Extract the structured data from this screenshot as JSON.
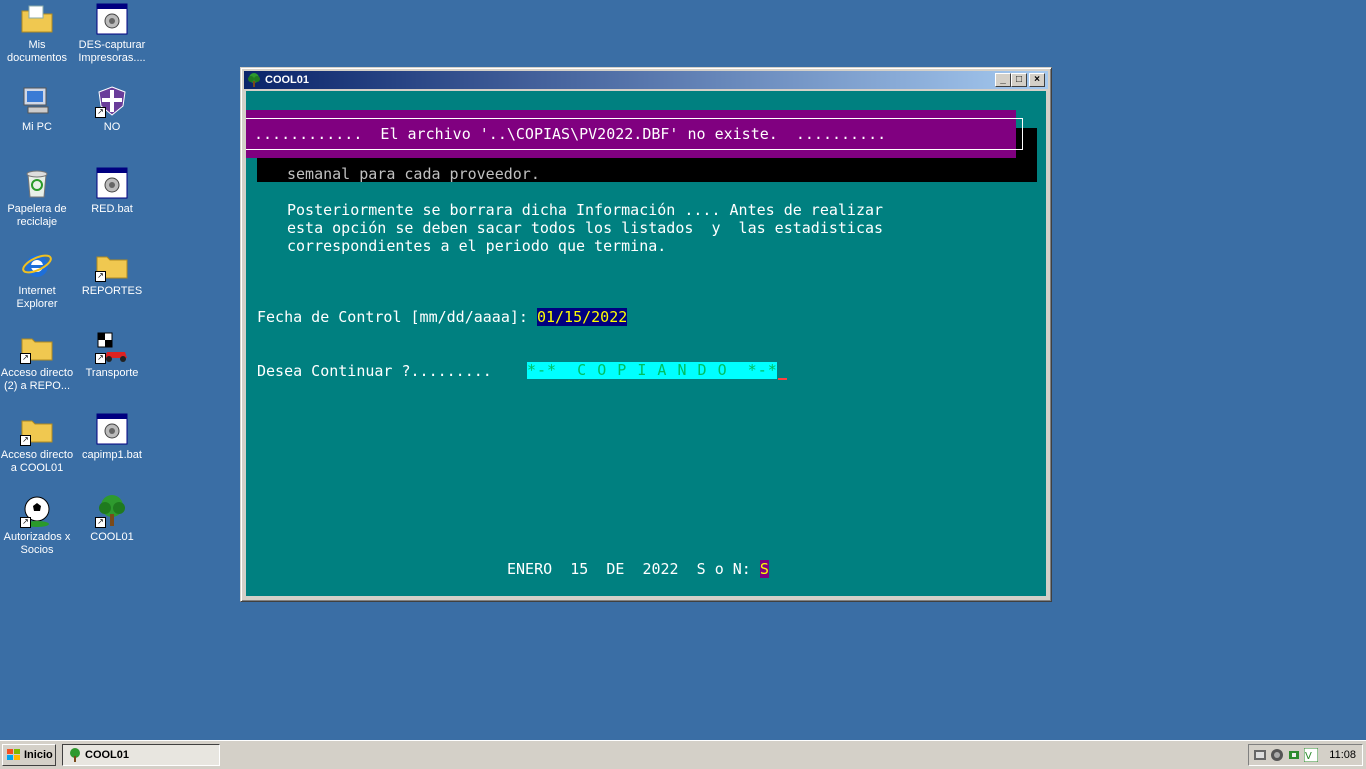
{
  "desktop": {
    "icons": [
      {
        "label": "Mis documentos",
        "icon": "folder-documents-icon"
      },
      {
        "label": "DES-capturar Impresoras....",
        "icon": "batch-file-icon"
      },
      {
        "label": "Mi PC",
        "icon": "computer-icon"
      },
      {
        "label": "NO",
        "icon": "shield-shortcut-icon"
      },
      {
        "label": "Papelera de reciclaje",
        "icon": "recycle-bin-icon"
      },
      {
        "label": "RED.bat",
        "icon": "batch-file-icon"
      },
      {
        "label": "Internet Explorer",
        "icon": "internet-explorer-icon"
      },
      {
        "label": "REPORTES",
        "icon": "folder-shortcut-icon"
      },
      {
        "label": "Acceso directo (2) a REPO...",
        "icon": "folder-shortcut-icon"
      },
      {
        "label": "Transporte",
        "icon": "race-car-icon"
      },
      {
        "label": "Acceso directo a COOL01",
        "icon": "folder-shortcut-icon"
      },
      {
        "label": "capimp1.bat",
        "icon": "batch-file-icon"
      },
      {
        "label": "Autorizados x Socios",
        "icon": "soccer-ball-icon"
      },
      {
        "label": "COOL01",
        "icon": "tree-icon"
      }
    ]
  },
  "window": {
    "title": "COOL01",
    "controls": {
      "minimize": "_",
      "maximize": "□",
      "close": "×"
    }
  },
  "console": {
    "error_message": "............  El archivo '..\\COPIAS\\PV2022.DBF' no existe.  ..........",
    "line_semanal": "semanal para cada proveedor.",
    "paragraph": [
      "Posteriormente se borrara dicha Información .... Antes de realizar",
      "esta opción se deben sacar todos los listados  y  las estadisticas",
      "correspondientes a el periodo que termina."
    ],
    "fecha_label": "Fecha de Control [mm/dd/aaaa]: ",
    "fecha_value": "01/15/2022",
    "desea_label": "Desea Continuar ?.........",
    "copiando_text": "*-*  C O P I A N D O  *-*",
    "status_date": "ENERO  15  DE  2022  S o N: ",
    "status_answer": "S"
  },
  "taskbar": {
    "start_label": "Inicio",
    "task_label": "COOL01",
    "clock": "11:08"
  }
}
